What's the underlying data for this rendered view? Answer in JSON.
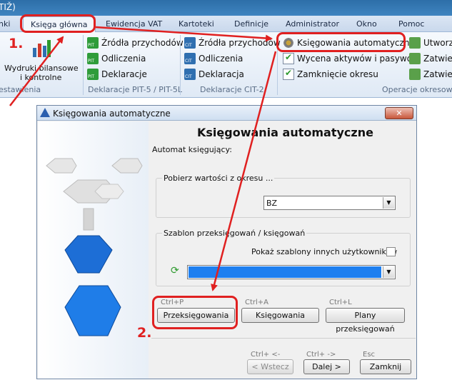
{
  "window": {
    "title_fragment": "TIŽ)"
  },
  "tabs": [
    {
      "label": "nki"
    },
    {
      "label": "Księga główna",
      "active": true
    },
    {
      "label": "Ewidencja VAT"
    },
    {
      "label": "Kartoteki"
    },
    {
      "label": "Definicje"
    },
    {
      "label": "Administrator"
    },
    {
      "label": "Okno"
    },
    {
      "label": "Pomoc"
    }
  ],
  "ribbon": {
    "reports": {
      "line1": "Wydruki bilansowe",
      "line2": "i kontrolne",
      "group": "estawienia"
    },
    "pit_group": {
      "label": "Deklaracje PIT-5 / PIT-5L",
      "items": [
        "Źródła przychodów",
        "Odliczenia",
        "Deklaracje"
      ]
    },
    "cit_group": {
      "label": "Deklaracje CIT-2",
      "items": [
        "Źródła przychodów",
        "Odliczenia",
        "Deklaracja"
      ]
    },
    "ops_group": {
      "label": "Operacje okresowe",
      "items": [
        "Księgowania automatyczne",
        "Wycena aktywów i pasywów",
        "Zamknięcie okresu"
      ],
      "extra": [
        "Utworz",
        "Zatwierd",
        "Zatwierd"
      ]
    }
  },
  "dialog": {
    "title": "Księgowania automatyczne",
    "heading": "Księgowania automatyczne",
    "automat_label": "Automat księgujący:",
    "period_group": "Pobierz wartości z okresu ...",
    "period_value": "BZ",
    "template_group": "Szablon przeksięgowań / księgowań",
    "show_others_label": "Pokaż szablony innych użytkowników",
    "buttons": [
      {
        "shortcut": "Ctrl+P",
        "label": "Przeksięgowania"
      },
      {
        "shortcut": "Ctrl+A",
        "label": "Księgowania"
      },
      {
        "shortcut": "Ctrl+L",
        "label": "Plany przeksięgowań"
      }
    ],
    "nav": [
      {
        "shortcut": "Ctrl+ <-",
        "label": "< Wstecz",
        "disabled": true
      },
      {
        "shortcut": "Ctrl+ ->",
        "label": "Dalej >"
      },
      {
        "shortcut": "Esc",
        "label": "Zamknij"
      }
    ]
  },
  "annotations": {
    "step1": "1.",
    "step2": "2."
  },
  "colors": {
    "annotation": "#e02020",
    "accent_blue": "#1e7ff0",
    "ribbon": "#dfe9f5"
  }
}
